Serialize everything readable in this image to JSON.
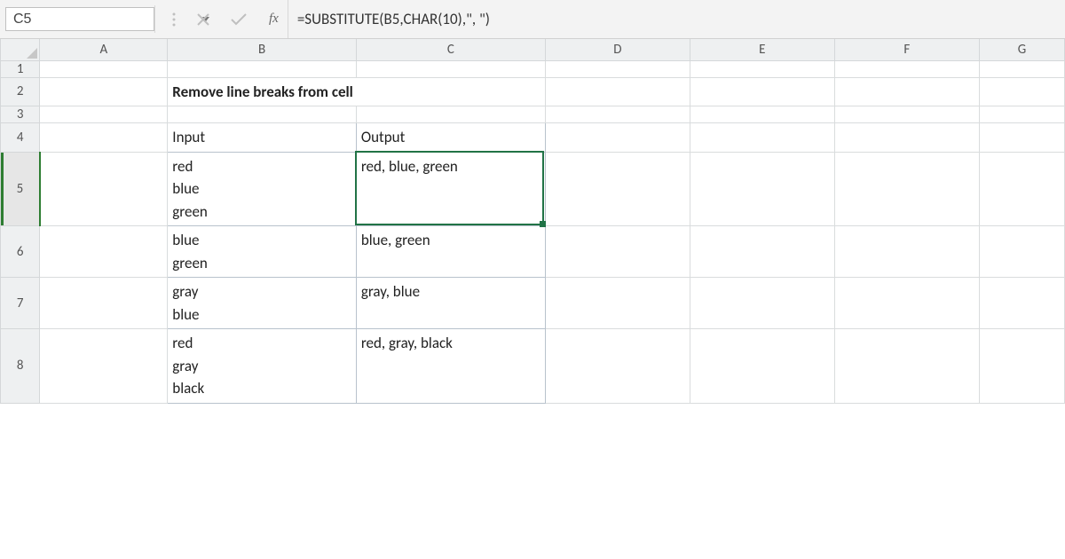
{
  "toolbar": {
    "name_box": "C5",
    "fx_label": "fx",
    "formula": "=SUBSTITUTE(B5,CHAR(10),\", \")"
  },
  "columns": [
    "A",
    "B",
    "C",
    "D",
    "E",
    "F",
    "G"
  ],
  "rows": [
    "1",
    "2",
    "3",
    "4",
    "5",
    "6",
    "7",
    "8"
  ],
  "selected_row": "5",
  "title": "Remove line breaks from cell",
  "table": {
    "headers": {
      "input": "Input",
      "output": "Output"
    },
    "rows": [
      {
        "input": "red\nblue\ngreen",
        "output": "red, blue, green"
      },
      {
        "input": "blue\ngreen",
        "output": "blue, green"
      },
      {
        "input": "gray\nblue",
        "output": "gray, blue"
      },
      {
        "input": "red\ngray\nblack",
        "output": "red, gray, black"
      }
    ]
  },
  "selected_cell": "C5",
  "colors": {
    "brand": "#217346",
    "header_fill": "#e4e9f2"
  }
}
